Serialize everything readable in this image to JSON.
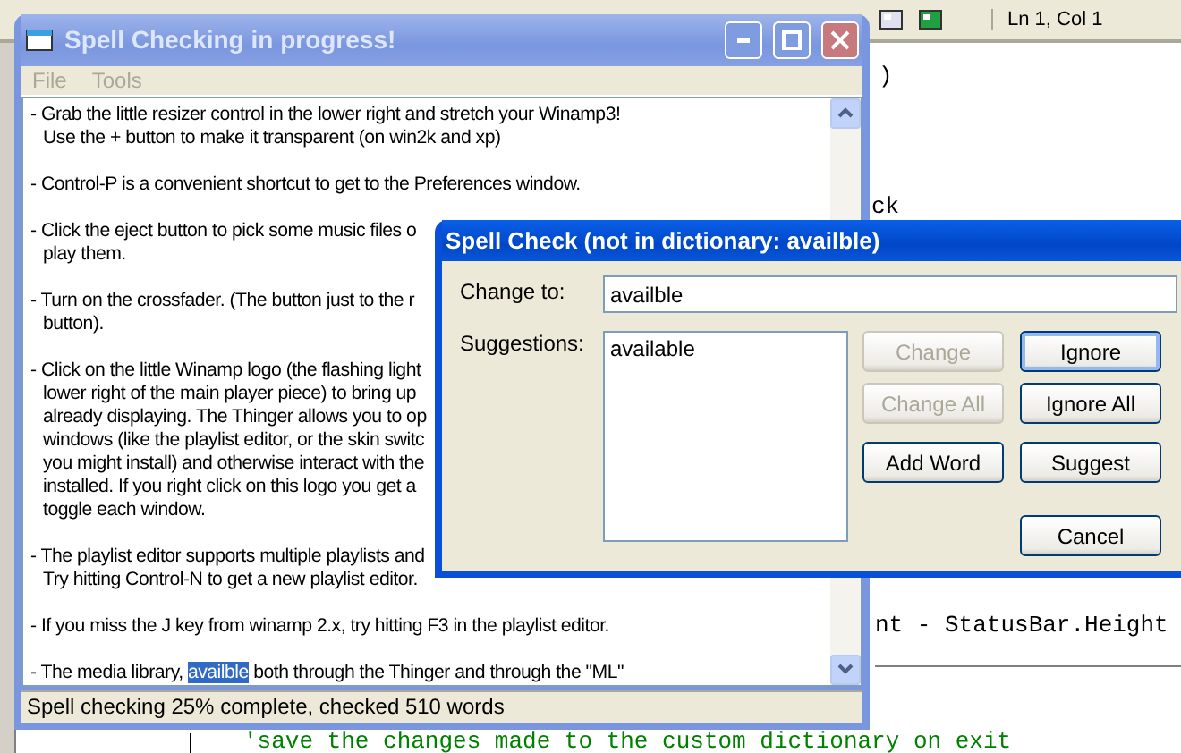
{
  "ide": {
    "position": "Ln 1, Col 1",
    "code_lines": [
      {
        "text": ")",
        "kind": "code"
      },
      {
        "text": "ck",
        "kind": "code"
      },
      {
        "text": "nt - StatusBar.Height",
        "kind": "code"
      },
      {
        "text": "'save the changes made to the custom dictionary on exit",
        "kind": "comment"
      }
    ]
  },
  "main_window": {
    "title": "Spell Checking in progress!",
    "menu": [
      {
        "label": "File",
        "disabled": true
      },
      {
        "label": "Tools",
        "disabled": true
      }
    ],
    "paragraphs": [
      {
        "lines": [
          "- Grab the little resizer control in the lower right and stretch your Winamp3!",
          "Use the + button to make it transparent (on win2k and xp)"
        ]
      },
      {
        "lines": [
          "- Control-P is a convenient shortcut to get to the Preferences window."
        ]
      },
      {
        "lines": [
          "- Click the eject button to pick some music files o",
          "play them."
        ]
      },
      {
        "lines": [
          "- Turn on the crossfader. (The button just to the r",
          "button)."
        ]
      },
      {
        "lines": [
          "- Click on the little Winamp logo (the flashing light",
          "lower right of the main player piece) to bring up",
          "already displaying. The Thinger allows you to op",
          "windows (like the playlist editor, or the skin switc",
          "you might install) and otherwise interact with the",
          "installed. If you right click on this logo you get a",
          "toggle each window."
        ]
      },
      {
        "lines": [
          "- The playlist editor supports multiple playlists and",
          "Try hitting Control-N to get a new playlist editor."
        ]
      },
      {
        "lines": [
          "- If you miss the J key from winamp 2.x, try hitting F3 in the playlist editor."
        ]
      },
      {
        "lines": [
          {
            "segments": [
              {
                "text": "- The media library, ",
                "selected": false
              },
              {
                "text": "availble",
                "selected": true
              },
              {
                "text": " both through the Thinger and through the \"ML\"",
                "selected": false
              }
            ]
          }
        ]
      }
    ],
    "status_bar": "Spell checking 25% complete, checked 510 words"
  },
  "dialog": {
    "title": "Spell Check (not in dictionary: availble)",
    "change_to_label": "Change to:",
    "change_to_value": "availble",
    "suggestions_label": "Suggestions:",
    "suggestions": [
      {
        "text": "available",
        "selected": false
      }
    ],
    "buttons": [
      {
        "label": "Change",
        "disabled": true,
        "default": false
      },
      {
        "label": "Ignore",
        "disabled": false,
        "default": true
      },
      {
        "label": "Change All",
        "disabled": true,
        "default": false
      },
      {
        "label": "Ignore All",
        "disabled": false,
        "default": false
      },
      {
        "label": "Add Word",
        "disabled": false,
        "default": false
      },
      {
        "label": "Suggest",
        "disabled": false,
        "default": false
      },
      {
        "label": "Cancel",
        "disabled": false,
        "default": false
      }
    ]
  }
}
